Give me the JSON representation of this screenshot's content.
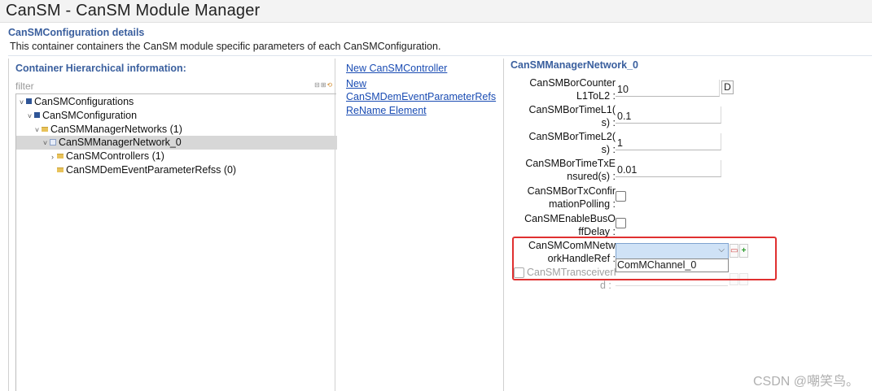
{
  "window": {
    "title": "CanSM - CanSM Module Manager"
  },
  "details": {
    "title": "CanSMConfiguration details",
    "description": "This container containers the CanSM module specific parameters of each CanSMConfiguration."
  },
  "left_panel": {
    "title": "Container Hierarchical information:",
    "filter_placeholder": "filter",
    "tree": [
      {
        "label": "CanSMConfigurations",
        "twisty": "˅",
        "icon": "module-icon"
      },
      {
        "label": "CanSMConfiguration",
        "twisty": "˅",
        "icon": "module-icon"
      },
      {
        "label": "CanSMManagerNetworks (1)",
        "twisty": "˅",
        "icon": "folder-icon"
      },
      {
        "label": "CanSMManagerNetwork_0",
        "twisty": "˅",
        "icon": "item-icon",
        "selected": true
      },
      {
        "label": "CanSMControllers (1)",
        "twisty": "›",
        "icon": "folder-icon"
      },
      {
        "label": "CanSMDemEventParameterRefss (0)",
        "twisty": "",
        "icon": "folder-icon"
      }
    ]
  },
  "actions": {
    "new_controller": "New CanSMController",
    "new_dem_1": "New",
    "new_dem_2": "CanSMDemEventParameterRefs",
    "rename": "ReName Element"
  },
  "right_panel": {
    "title": "CanSMManagerNetwork_0",
    "fields": {
      "bor_counter": {
        "label1": "CanSMBorCounter",
        "label2": "L1ToL2 :",
        "value": "10",
        "button": "D"
      },
      "bor_time_l1": {
        "label1": "CanSMBorTimeL1(",
        "label2": "s) :",
        "value": "0.1"
      },
      "bor_time_l2": {
        "label1": "CanSMBorTimeL2(",
        "label2": "s) :",
        "value": "1"
      },
      "bor_time_tx": {
        "label1": "CanSMBorTimeTxE",
        "label2": "nsured(s) :",
        "value": "0.01"
      },
      "bor_tx_confirm": {
        "label1": "CanSMBorTxConfir",
        "label2": "mationPolling :"
      },
      "enable_bus_off": {
        "label1": "CanSMEnableBusO",
        "label2": "ffDelay :"
      },
      "comm_network": {
        "label1": "CanSMComMNetw",
        "label2": "orkHandleRef :",
        "selected": "",
        "option": "ComMChannel_0"
      },
      "transceiver": {
        "label1": "CanSMTransceiverI",
        "label2": "d :"
      }
    }
  },
  "watermark": "CSDN @嘲笑鸟。",
  "colors": {
    "accent": "#3a5f9e",
    "link": "#1a4cb3",
    "highlight": "#e03030",
    "select_bg": "#cfe2f6"
  }
}
